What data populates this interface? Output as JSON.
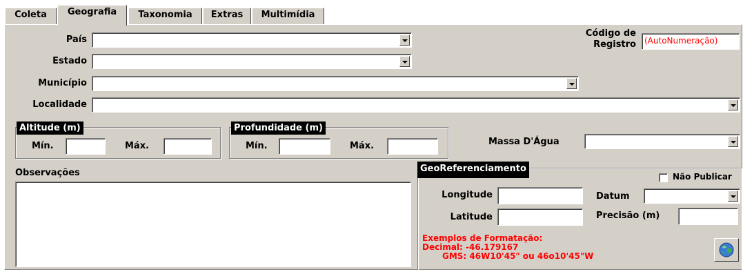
{
  "tabs": [
    {
      "label": "Coleta"
    },
    {
      "label": "Geografia"
    },
    {
      "label": "Taxonomia"
    },
    {
      "label": "Extras"
    },
    {
      "label": "Multimídia"
    }
  ],
  "fields": {
    "pais": {
      "label": "País",
      "value": ""
    },
    "estado": {
      "label": "Estado",
      "value": ""
    },
    "municipio": {
      "label": "Município",
      "value": ""
    },
    "localidade": {
      "label": "Localidade",
      "value": ""
    },
    "codigo_registro": {
      "label_line1": "Código de",
      "label_line2": "Registro",
      "value": "(AutoNumeração)"
    }
  },
  "altitude": {
    "title": "Altitude (m)",
    "min_label": "Mín.",
    "max_label": "Máx.",
    "min_value": "",
    "max_value": ""
  },
  "profundidade": {
    "title": "Profundidade (m)",
    "min_label": "Mín.",
    "max_label": "Máx.",
    "min_value": "",
    "max_value": ""
  },
  "massa_agua": {
    "label": "Massa D'Água",
    "value": ""
  },
  "observacoes": {
    "label": "Observações",
    "value": ""
  },
  "georef": {
    "title": "GeoReferenciamento",
    "nao_publicar": "Não Publicar",
    "longitude_label": "Longitude",
    "latitude_label": "Latitude",
    "datum_label": "Datum",
    "precisao_label": "Precisão (m)",
    "examples_title": "Exemplos de Formatação:",
    "examples_decimal": "Decimal: -46.179167",
    "examples_gms": "GMS: 46W10'45\" ou 46o10'45\"W"
  },
  "colors": {
    "panel": "#d4d0c8",
    "example_text": "#ff0000",
    "auto_number": "#ff0000"
  }
}
